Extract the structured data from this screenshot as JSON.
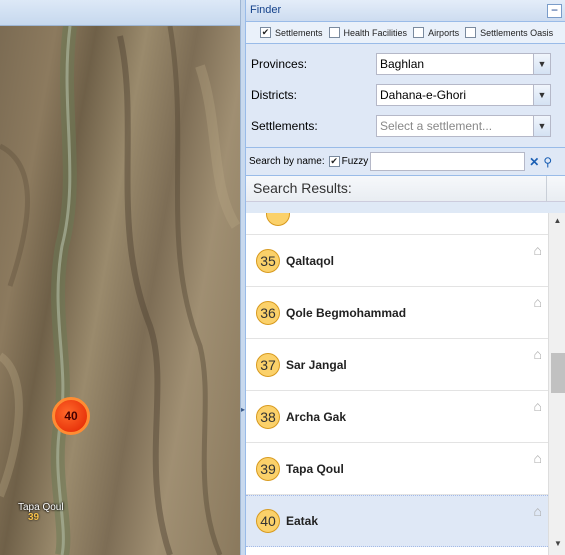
{
  "finder": {
    "title": "Finder",
    "collapse_icon": "minus-icon",
    "filters": [
      {
        "label": "Settlements",
        "checked": true
      },
      {
        "label": "Health Facilities",
        "checked": false
      },
      {
        "label": "Airports",
        "checked": false
      },
      {
        "label": "Settlements Oasis",
        "checked": false
      }
    ],
    "provinces_label": "Provinces:",
    "provinces_value": "Baghlan",
    "districts_label": "Districts:",
    "districts_value": "Dahana-e-Ghori",
    "settlements_label": "Settlements:",
    "settlements_placeholder": "Select a settlement...",
    "search_label": "Search by name:",
    "fuzzy_label": "Fuzzy",
    "fuzzy_checked": true,
    "search_value": ""
  },
  "results": {
    "header": "Search Results:",
    "items": [
      {
        "num": "35",
        "name": "Qaltaqol"
      },
      {
        "num": "36",
        "name": "Qole Begmohammad"
      },
      {
        "num": "37",
        "name": "Sar Jangal"
      },
      {
        "num": "38",
        "name": "Archa Gak"
      },
      {
        "num": "39",
        "name": "Tapa Qoul"
      },
      {
        "num": "40",
        "name": "Eatak"
      }
    ],
    "selected_num": "40"
  },
  "map": {
    "cluster_label": "40",
    "place_label": "Tapa Qoul",
    "place_num": "39"
  }
}
